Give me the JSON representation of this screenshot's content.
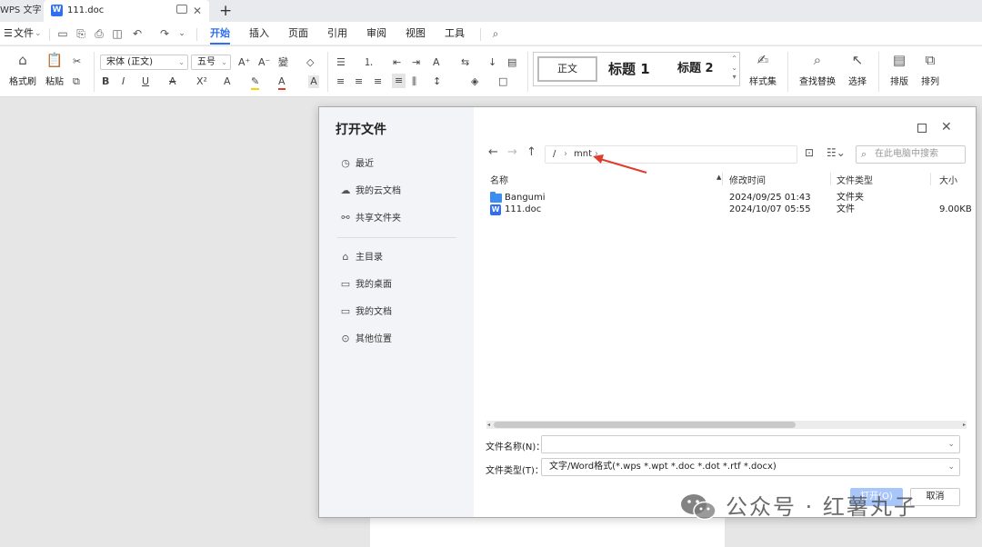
{
  "tabbar": {
    "app_label": "WPS 文字",
    "doc_tab_title": "111.doc",
    "new_tab": "+"
  },
  "menu": {
    "file": "文件",
    "tabs": [
      "开始",
      "插入",
      "页面",
      "引用",
      "审阅",
      "视图",
      "工具"
    ],
    "active_tab": "开始"
  },
  "ribbon": {
    "format_painter": "格式刷",
    "paste": "粘贴",
    "font_name": "宋体 (正文)",
    "font_size": "五号",
    "styles": [
      "正文",
      "标题 1",
      "标题 2"
    ],
    "style_set": "样式集",
    "find_replace": "查找替换",
    "select": "选择",
    "layout": "排版",
    "arrange": "排列"
  },
  "dialog": {
    "title": "打开文件",
    "sidebar": {
      "quick": [
        "最近",
        "我的云文档",
        "共享文件夹"
      ],
      "locations": [
        "主目录",
        "我的桌面",
        "我的文档",
        "其他位置"
      ]
    },
    "path": [
      "/",
      "mnt"
    ],
    "search_placeholder": "在此电脑中搜索",
    "columns": [
      "名称",
      "修改时间",
      "文件类型",
      "大小"
    ],
    "files": [
      {
        "name": "Bangumi",
        "modified": "2024/09/25 01:43",
        "type": "文件夹",
        "size": ""
      },
      {
        "name": "111.doc",
        "modified": "2024/10/07 05:55",
        "type": "文件",
        "size": "9.00KB"
      }
    ],
    "filename_label": "文件名称(N)：",
    "filename_value": "",
    "filetype_label": "文件类型(T)：",
    "filetype_value": "文字/Word格式(*.wps *.wpt *.doc *.dot *.rtf *.docx)",
    "open_button": "打开(O)",
    "cancel_button": "取消"
  },
  "watermark": {
    "text": "公众号 · 红薯丸子"
  },
  "colors": {
    "accent": "#2f6ff3",
    "annotation_arrow": "#e03c2d",
    "folder": "#3b8ef0"
  }
}
